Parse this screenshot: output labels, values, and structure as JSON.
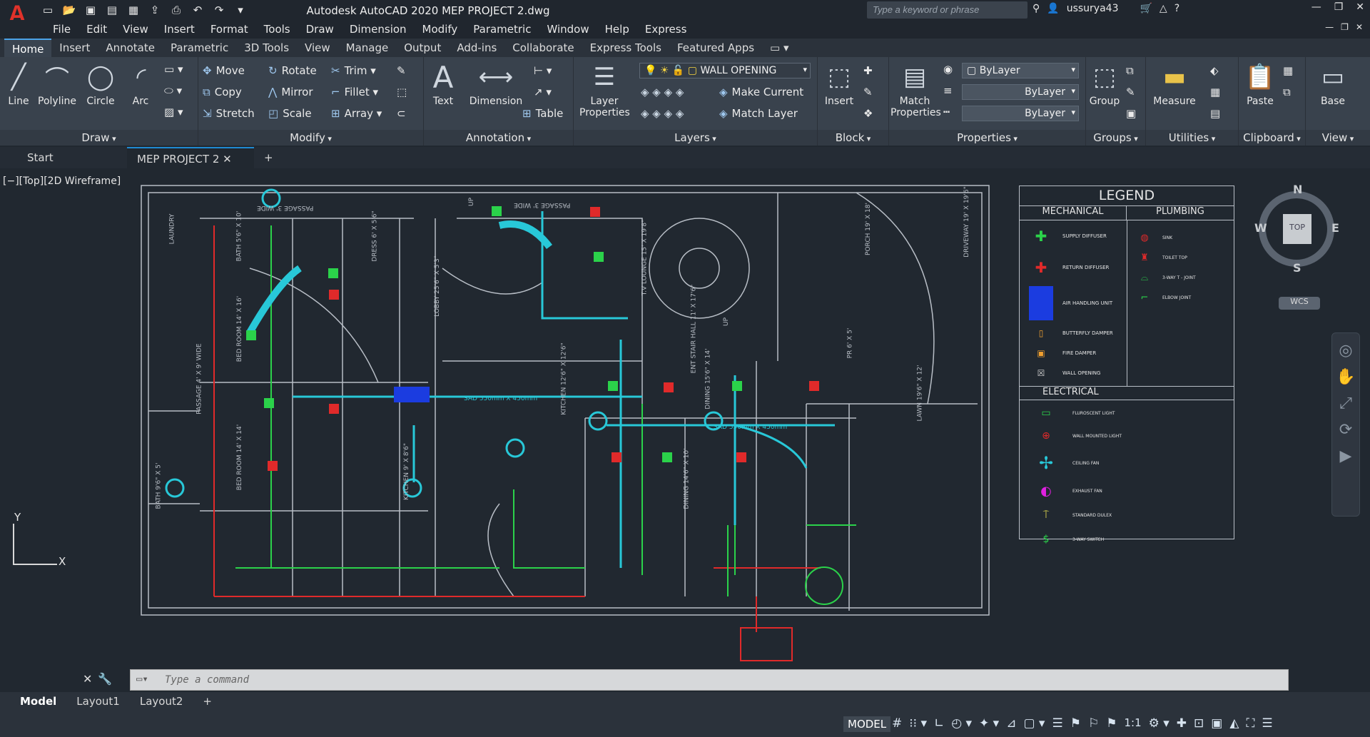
{
  "title": "Autodesk AutoCAD 2020    MEP PROJECT 2.dwg",
  "search_placeholder": "Type a keyword or phrase",
  "user": "ussurya43",
  "menu": [
    "File",
    "Edit",
    "View",
    "Insert",
    "Format",
    "Tools",
    "Draw",
    "Dimension",
    "Modify",
    "Parametric",
    "Window",
    "Help",
    "Express"
  ],
  "ribbon_tabs": [
    "Home",
    "Insert",
    "Annotate",
    "Parametric",
    "3D Tools",
    "View",
    "Manage",
    "Output",
    "Add-ins",
    "Collaborate",
    "Express Tools",
    "Featured Apps"
  ],
  "panels": {
    "draw": {
      "title": "Draw",
      "line": "Line",
      "polyline": "Polyline",
      "circle": "Circle",
      "arc": "Arc"
    },
    "modify": {
      "title": "Modify",
      "move": "Move",
      "rotate": "Rotate",
      "trim": "Trim",
      "copy": "Copy",
      "mirror": "Mirror",
      "fillet": "Fillet",
      "stretch": "Stretch",
      "scale": "Scale",
      "array": "Array"
    },
    "annotation": {
      "title": "Annotation",
      "text": "Text",
      "dimension": "Dimension",
      "table": "Table"
    },
    "layers": {
      "title": "Layers",
      "layer_properties": "Layer Properties",
      "current_layer": "WALL OPENING",
      "make_current": "Make Current",
      "match_layer": "Match Layer"
    },
    "block": {
      "title": "Block",
      "insert": "Insert"
    },
    "properties": {
      "title": "Properties",
      "match_properties": "Match Properties",
      "color": "ByLayer",
      "linetype": "ByLayer",
      "lineweight": "ByLayer"
    },
    "groups": {
      "title": "Groups",
      "group": "Group"
    },
    "utilities": {
      "title": "Utilities",
      "measure": "Measure"
    },
    "clipboard": {
      "title": "Clipboard",
      "paste": "Paste"
    },
    "view": {
      "title": "View",
      "base": "Base"
    }
  },
  "doc_tabs": {
    "start": "Start",
    "active": "MEP PROJECT 2"
  },
  "viewport_label": "[−][Top][2D Wireframe]",
  "viewcube": {
    "top": "TOP",
    "n": "N",
    "s": "S",
    "e": "E",
    "w": "W",
    "wcs": "WCS"
  },
  "ucs": {
    "x": "X",
    "y": "Y"
  },
  "legend": {
    "title": "LEGEND",
    "mechanical": "MECHANICAL",
    "plumbing": "PLUMBING",
    "electrical": "ELECTRICAL",
    "mech_items": [
      "SUPPLY DIFFUSER",
      "RETURN DIFFUSER",
      "AIR HANDLING UNIT",
      "BUTTERFLY DAMPER",
      "FIRE DAMPER",
      "WALL OPENING"
    ],
    "plumb_items": [
      "SINK",
      "TOILET TOP",
      "3-WAY T - JOINT",
      "ELBOW JOINT"
    ],
    "elec_items": [
      "FLUROSCENT LIGHT",
      "WALL MOUNTED LIGHT",
      "CEILING FAN",
      "EXHAUST FAN",
      "STANDARD DULEX",
      "3-WAY SWITCH"
    ]
  },
  "rooms": [
    "LAUNDRY",
    "BATH 5'6\" X 10'",
    "DRESS 6' X 5'6\"",
    "BED ROOM 14' X 16'",
    "PASSAGE 4' X 9' WIDE",
    "BED ROOM 14' X 14'",
    "BATH 9'6\" X 5'",
    "KITCHEN 9' X 8'6\"",
    "LOBBY 25'6\" X 5'3\"",
    "T.V LOUNGE 15' X 19'8\"",
    "KITCHEN 12'6\" X 12'6\"",
    "DINING 15'6\" X 14'",
    "DINING 14'6\" X 10'",
    "ENT STAIR HALL 11' X 17'6\"",
    "PORCH 19' X 18'",
    "DRIVEWAY 19' X 19'6\"",
    "PR 6' X 5'",
    "LAWN 19'6\" X 12'",
    "PASSAGE 3' WIDE",
    "PASSAGE 3' WIDE",
    "UP",
    "UP",
    "SAD 550mm X 450mm",
    "SAD 550mm X 450mm"
  ],
  "command_placeholder": "Type a command",
  "layouts": [
    "Model",
    "Layout1",
    "Layout2"
  ],
  "status": {
    "model": "MODEL",
    "scale": "1:1"
  }
}
